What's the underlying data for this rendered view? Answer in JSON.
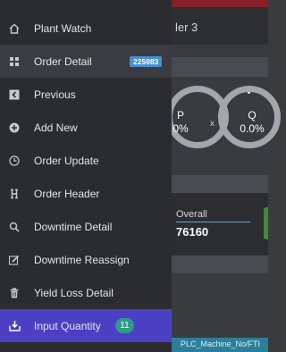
{
  "background": {
    "title_fragment": "ler 3",
    "ring_left_text": [
      "P",
      "0%"
    ],
    "ring_right_text": [
      "Q",
      "0.0%"
    ],
    "x_mark": "x",
    "overall_label": "Overall",
    "overall_value": "76160",
    "bottom_bar_text": "PLC_Machine_No/FTI"
  },
  "menu": {
    "items": [
      {
        "label": "Plant Watch",
        "icon": "home-icon"
      },
      {
        "label": "Order Detail",
        "icon": "grid-icon",
        "badge": "225983"
      },
      {
        "label": "Previous",
        "icon": "chevron-left-icon"
      },
      {
        "label": "Add New",
        "icon": "plus-circle-icon"
      },
      {
        "label": "Order Update",
        "icon": "clock-icon"
      },
      {
        "label": "Order Header",
        "icon": "header-h-icon"
      },
      {
        "label": "Downtime Detail",
        "icon": "search-icon"
      },
      {
        "label": "Downtime Reassign",
        "icon": "edit-icon"
      },
      {
        "label": "Yield Loss Detail",
        "icon": "trash-icon"
      },
      {
        "label": "Input Quantity",
        "icon": "download-tray-icon",
        "count": "11"
      }
    ]
  },
  "colors": {
    "drawer_bg": "#2b2c30",
    "selected_bg": "#3b3c41",
    "highlight_bg": "#4b3fc4",
    "badge_bg": "#4a8fd0",
    "pill_bg": "#2d9c86"
  }
}
